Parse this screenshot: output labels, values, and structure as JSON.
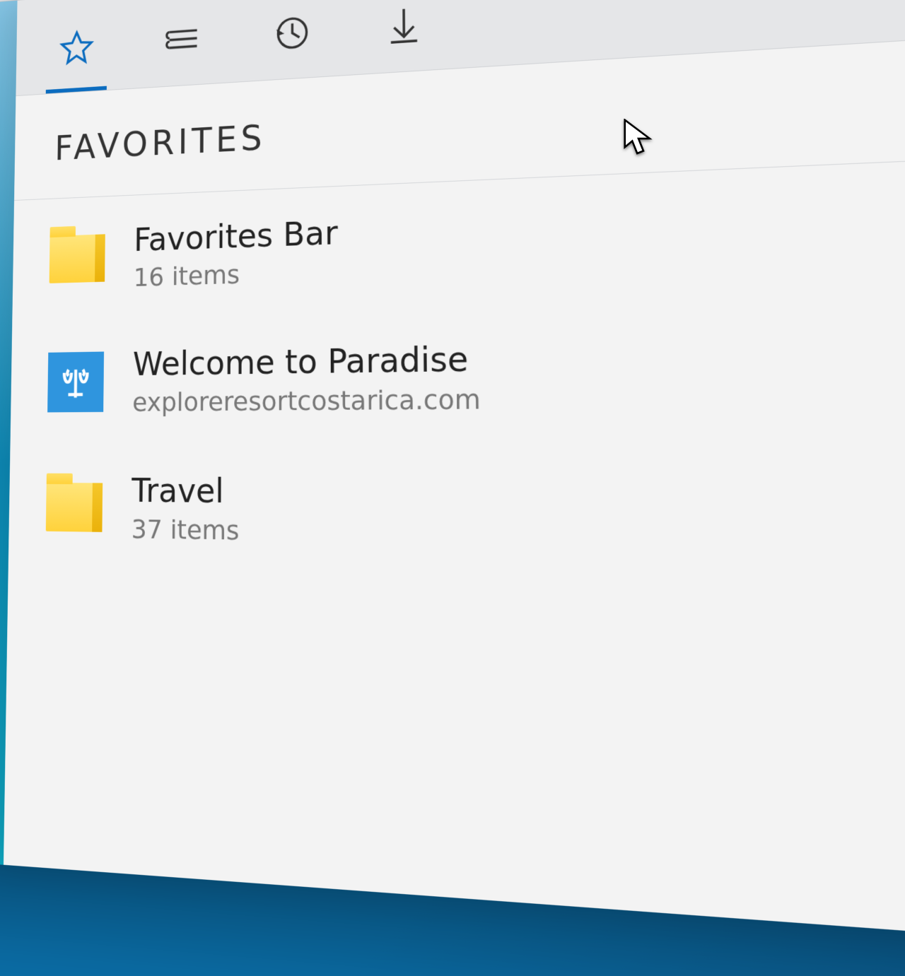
{
  "window_controls": {
    "minimize": "minimize",
    "maximize": "maximize",
    "close": "close"
  },
  "toolbar": {
    "reading_view": "reading-view",
    "favorite_star": "add-favorite",
    "hub_button": "hub",
    "web_note": "web-note",
    "more": "more"
  },
  "hub": {
    "tabs": {
      "favorites": "favorites",
      "reading_list": "reading-list",
      "history": "history",
      "downloads": "downloads"
    },
    "title": "FAVORITES",
    "items": [
      {
        "type": "folder",
        "title": "Favorites Bar",
        "subtitle": "16 items"
      },
      {
        "type": "site",
        "title": "Welcome to Paradise",
        "subtitle": "exploreresortcostarica.com"
      },
      {
        "type": "folder",
        "title": "Travel",
        "subtitle": "37 items"
      }
    ]
  },
  "colors": {
    "accent": "#0b6cbf",
    "folder": "#ffd23b",
    "tile": "#2f95de"
  }
}
